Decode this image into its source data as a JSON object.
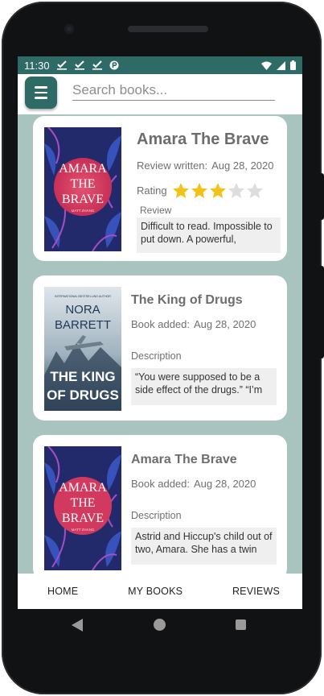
{
  "status_bar": {
    "time": "11:30",
    "icons": [
      "check-icon",
      "check-icon",
      "check-icon",
      "notification-icon",
      "wifi-icon",
      "signal-icon",
      "battery-icon"
    ]
  },
  "top_bar": {
    "menu_icon": "hamburger-menu-icon",
    "search_placeholder": "Search books...",
    "search_value": ""
  },
  "review_card": {
    "title": "Amara The Brave",
    "review_written_label": "Review written:",
    "review_written_date": "Aug 28, 2020",
    "rating_label": "Rating",
    "rating": 3,
    "rating_max": 5,
    "review_label": "Review",
    "review_excerpt": "Difficult to read. Impossible to put down. A powerful,",
    "cover": {
      "title_line1": "AMARA",
      "title_line2": "THE",
      "title_line3": "BRAVE",
      "author": "MATT ZHANG"
    }
  },
  "books": [
    {
      "title": "The King of Drugs",
      "added_label": "Book added:",
      "added_date": "Aug 28, 2020",
      "description_label": "Description",
      "description": "“You were supposed to be a side effect of the drugs.” “I’m",
      "cover": {
        "tagline": "INTERNATIONAL BESTSELLING AUTHOR",
        "author_line1": "NORA",
        "author_line2": "BARRETT",
        "title_line1": "THE KING",
        "title_line2": "OF DRUGS"
      }
    },
    {
      "title": "Amara The Brave",
      "added_label": "Book added:",
      "added_date": "Aug 28, 2020",
      "description_label": "Description",
      "description": "Astrid and Hiccup's child out of two, Amara. She has a twin",
      "cover": {
        "title_line1": "AMARA",
        "title_line2": "THE",
        "title_line3": "BRAVE",
        "author": "MATT ZHANG"
      }
    }
  ],
  "bottom_nav": {
    "home": "HOME",
    "my_books": "MY BOOKS",
    "reviews": "REVIEWS"
  },
  "colors": {
    "primary": "#2f6b66",
    "background": "#a9c3bf",
    "star_filled": "#f2c21a",
    "star_empty": "#dddddd"
  }
}
